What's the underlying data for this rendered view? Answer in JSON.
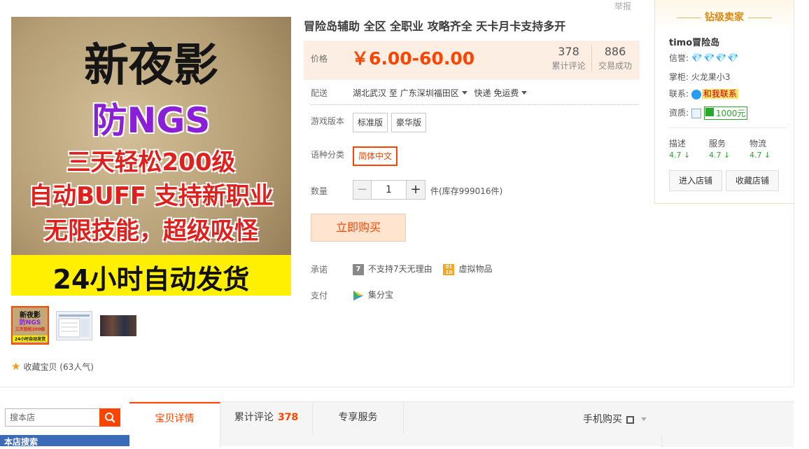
{
  "product": {
    "title": "冒险岛辅助 全区 全职业 攻略齐全 天卡月卡支持多开",
    "report": "举报",
    "image_lines": [
      "新夜影",
      "防NGS",
      "三天轻松200级",
      "自动BUFF 支持新职业",
      "无限技能，超级吸怪",
      "24小时自动发货"
    ],
    "thumb_lines": [
      "新夜影",
      "防NGS",
      "三天轻松200级",
      "24小时自动发货"
    ],
    "favorite": "收藏宝贝",
    "favorite_count": "(63人气)"
  },
  "price": {
    "label": "价格",
    "value": "￥6.00-60.00",
    "reviews_count": "378",
    "reviews_label": "累计评论",
    "sales_count": "886",
    "sales_label": "交易成功"
  },
  "shipping": {
    "label": "配送",
    "from": "湖北武汉",
    "to_word": "至",
    "to": "广东深圳福田区",
    "method": "快递 免运费"
  },
  "options": {
    "version_label": "游戏版本",
    "versions": [
      "标准版",
      "豪华版"
    ],
    "language_label": "语种分类",
    "language": "简体中文"
  },
  "quantity": {
    "label": "数量",
    "minus": "−",
    "value": "1",
    "plus": "+",
    "stock": "件(库存999016件)"
  },
  "buy_button": "立即购买",
  "promise": {
    "label": "承诺",
    "icon_text": "7",
    "no_return": "不支持7天无理由",
    "virtual": "虚拟物品"
  },
  "payment": {
    "label": "支付",
    "method": "集分宝"
  },
  "seller": {
    "title": "钻级卖家",
    "shop_name": "timo冒险岛",
    "credit_label": "信誉:",
    "credit_diamonds": "💎💎💎💎",
    "keeper_label": "掌柜:",
    "keeper": "火龙果小3",
    "contact_label": "联系:",
    "contact": "和我联系",
    "qual_label": "资质:",
    "deposit": "1000元",
    "scores": [
      {
        "label": "描述",
        "value": "4.7 ↓"
      },
      {
        "label": "服务",
        "value": "4.7 ↓"
      },
      {
        "label": "物流",
        "value": "4.7 ↓"
      }
    ],
    "enter_shop": "进入店铺",
    "favorite_shop": "收藏店铺"
  },
  "bottom": {
    "search_placeholder": "搜本店",
    "store_search": "本店搜索",
    "tabs": {
      "detail": "宝贝详情",
      "review": "累计评论",
      "review_count": "378",
      "service": "专享服务"
    },
    "mobile_buy": "手机购买"
  },
  "colors": {
    "accent": "#ff4400",
    "price_bg": "#fdeee3",
    "seller_title": "#d88a12",
    "score_green": "#2ba82b"
  }
}
